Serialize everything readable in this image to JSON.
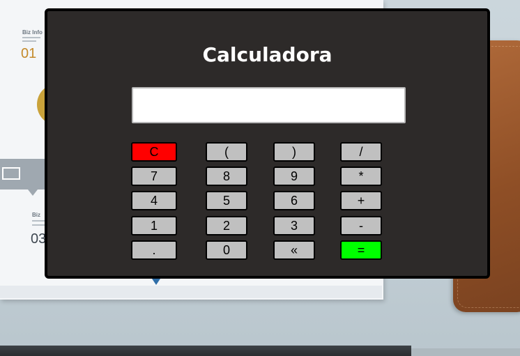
{
  "app": {
    "title": "Calculadora"
  },
  "display": {
    "value": "",
    "placeholder": ""
  },
  "keys": {
    "row1": [
      "C",
      "(",
      ")",
      "/"
    ],
    "row2": [
      "7",
      "8",
      "9",
      "*"
    ],
    "row3": [
      "4",
      "5",
      "6",
      "+"
    ],
    "row4": [
      "1",
      "2",
      "3",
      "-"
    ],
    "row5": [
      ".",
      "0",
      "«",
      "="
    ]
  },
  "background": {
    "biz_info": "Biz Info",
    "num_01": "01",
    "biz": "Biz",
    "num_03": "03"
  },
  "colors": {
    "panel": "#2d2a29",
    "key_default": "#c0c0c0",
    "key_clear": "#ff0000",
    "key_equals": "#00ff00",
    "title": "#ffffff"
  }
}
